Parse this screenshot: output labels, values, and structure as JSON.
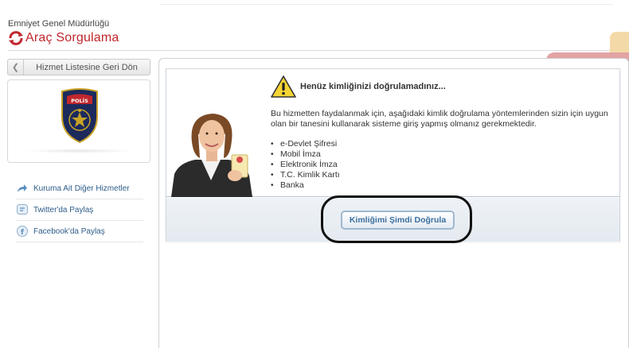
{
  "header": {
    "organization": "Emniyet Genel Müdürlüğü",
    "title": "Araç Sorgulama",
    "brand_color": "#c0272d"
  },
  "sidebar": {
    "back_label": "Hizmet Listesine Geri Dön",
    "links": [
      {
        "label": "Kuruma Ait Diğer Hizmetler",
        "icon": "share-arrow-icon"
      },
      {
        "label": "Twitter'da Paylaş",
        "icon": "twitter-icon"
      },
      {
        "label": "Facebook'da Paylaş",
        "icon": "facebook-icon"
      }
    ]
  },
  "notice": {
    "title": "Henüz kimliğinizi doğrulamadınız...",
    "description": "Bu hizmetten faydalanmak için, aşağıdaki kimlik doğrulama yöntemlerinden sizin için uygun olan bir tanesini kullanarak sisteme giriş yapmış olmanız gerekmektedir.",
    "methods": [
      "e-Devlet Şifresi",
      "Mobil İmza",
      "Elektronik İmza",
      "T.C. Kimlik Kartı",
      "Banka"
    ],
    "verify_button": "Kimliğimi Şimdi Doğrula"
  }
}
